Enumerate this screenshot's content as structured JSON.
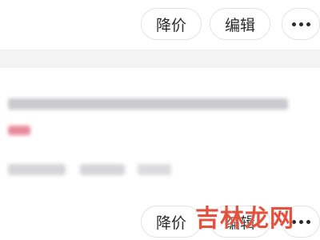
{
  "top_actions": {
    "price_down_label": "降价",
    "edit_label": "编辑",
    "more_icon": "ellipsis-icon"
  },
  "bottom_actions": {
    "price_down_label": "降价",
    "edit_label": "编辑",
    "more_icon": "ellipsis-icon"
  },
  "watermark": {
    "text": "吉林龙网"
  },
  "colors": {
    "border": "#e3e3e3",
    "separator_bg": "#f3f3f3",
    "watermark": "#e2523f",
    "blur_pink": "#e78a9c"
  }
}
